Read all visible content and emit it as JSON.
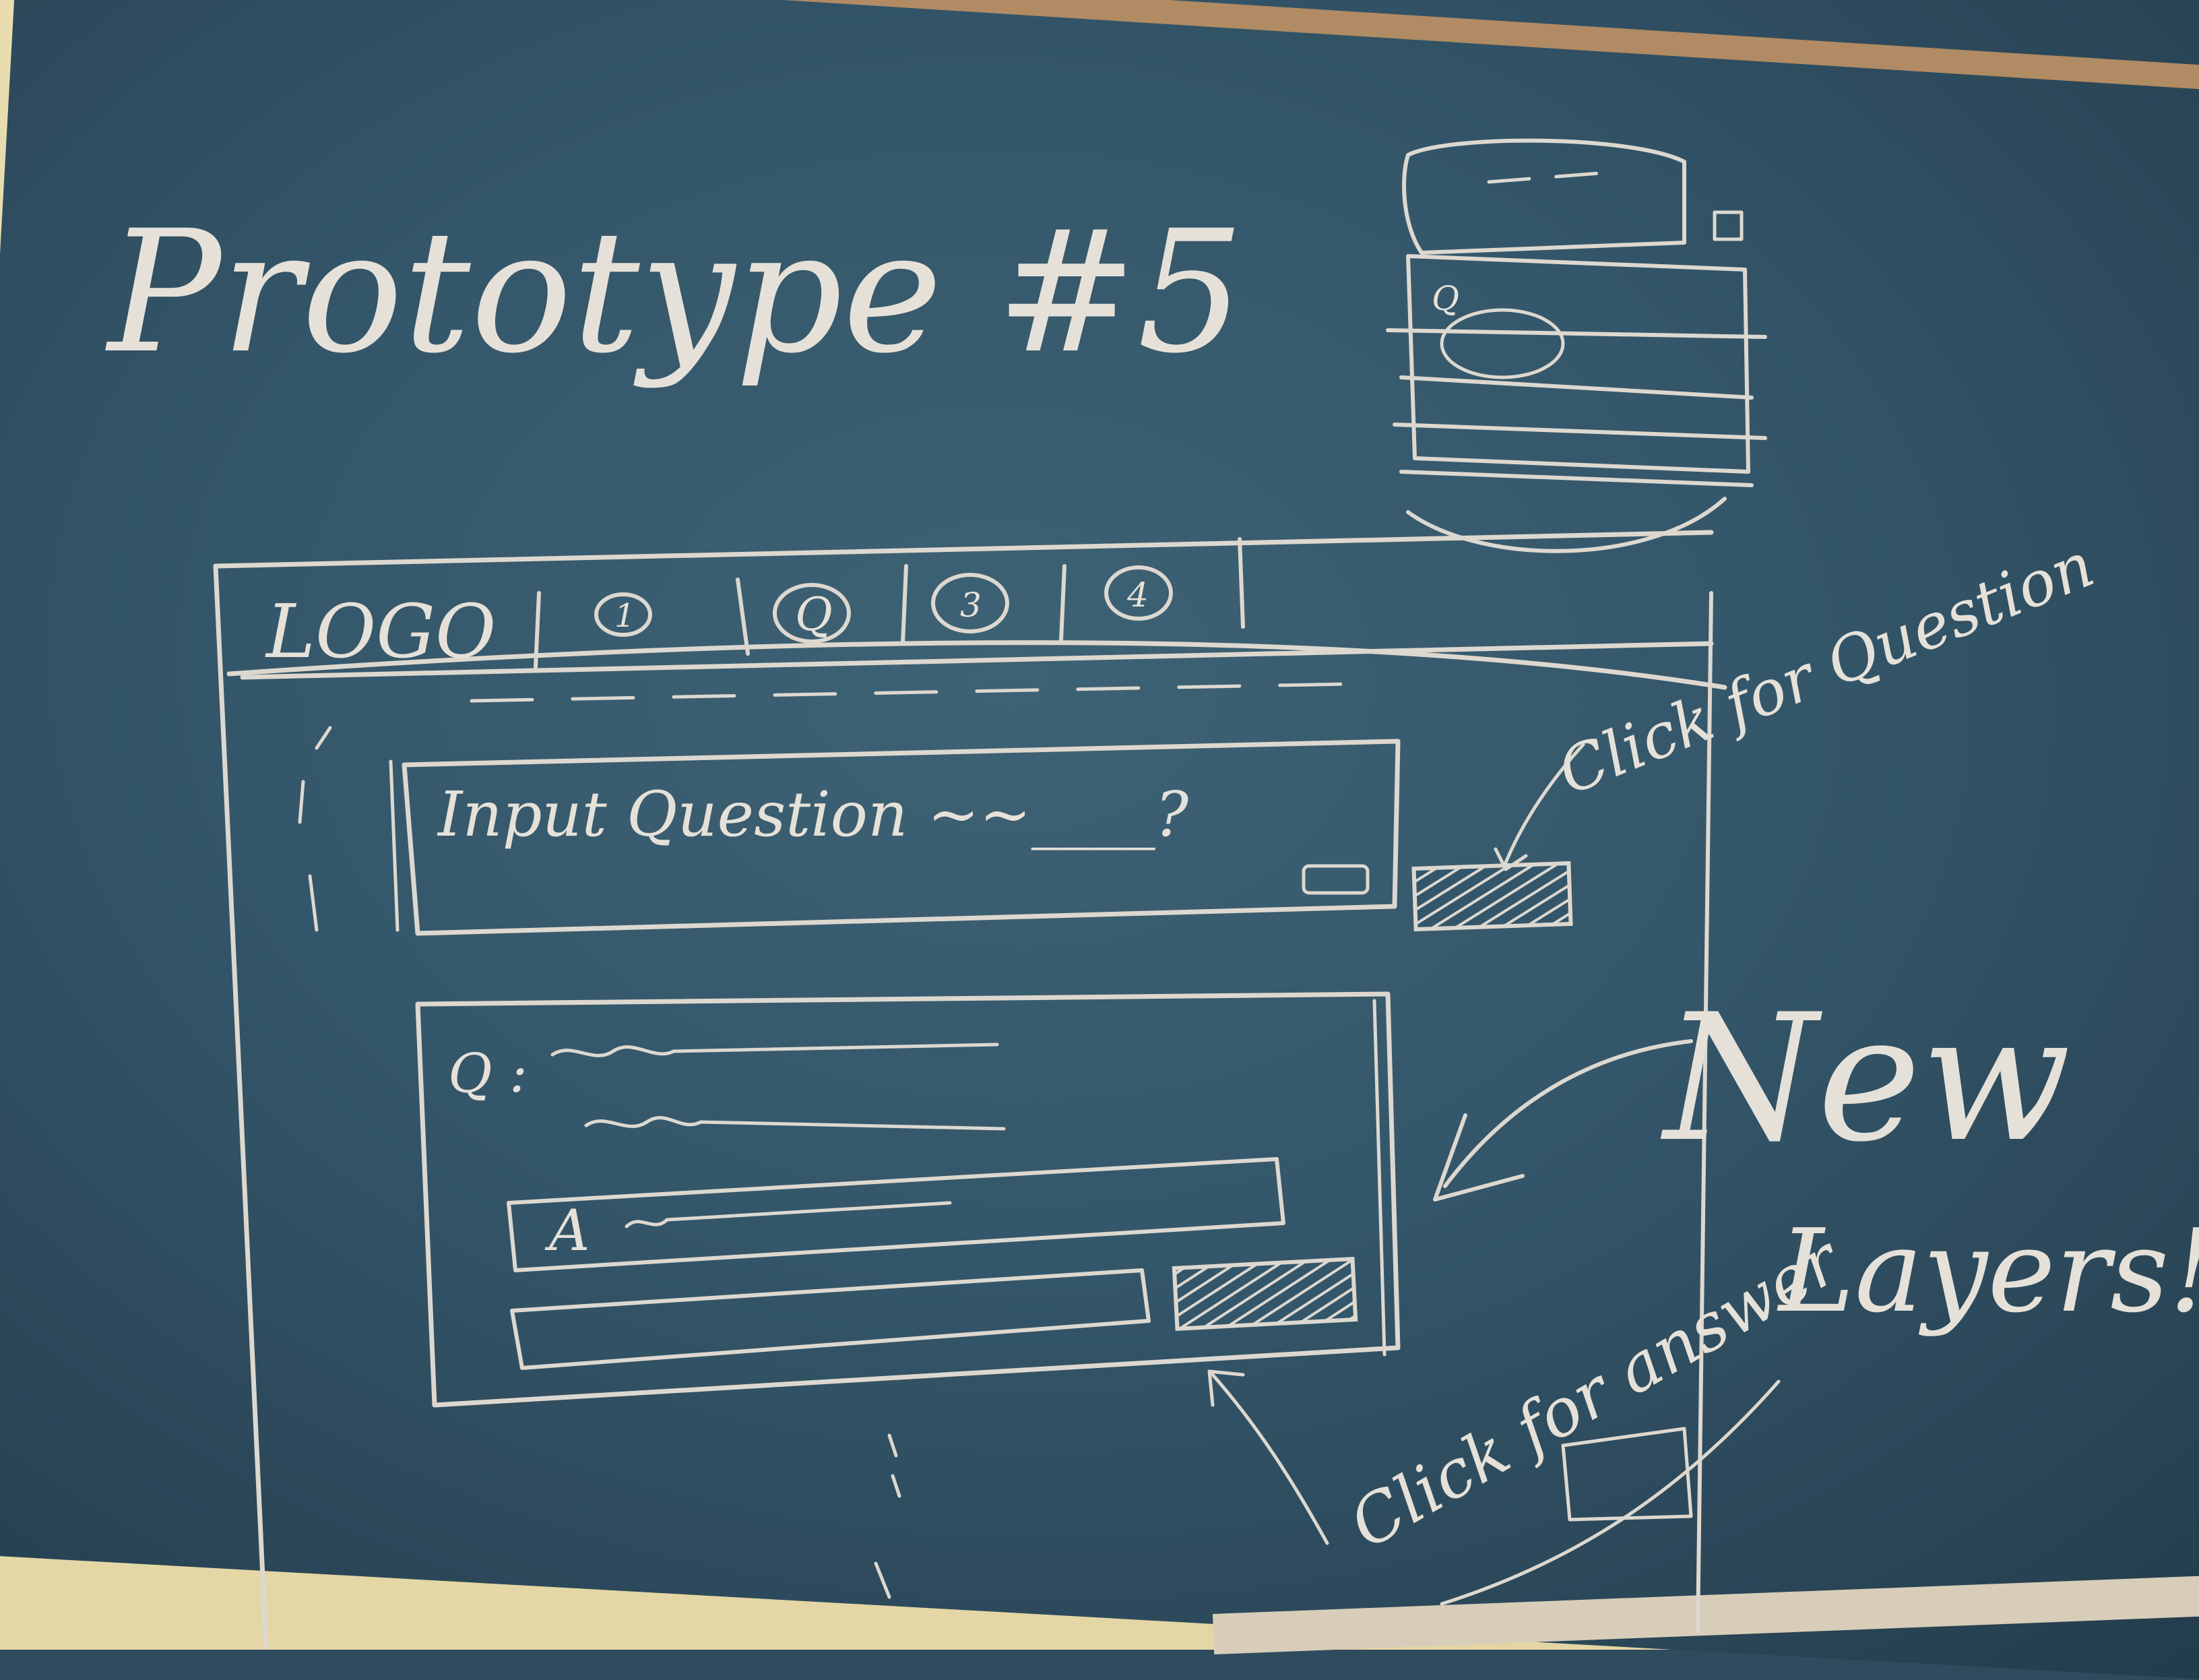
{
  "title": "Prototype #5",
  "nav": {
    "logo": "LOGO",
    "tabs": [
      "1",
      "Q",
      "3",
      "4"
    ]
  },
  "question_box": {
    "placeholder": "Input Question ~~____?"
  },
  "answer_card": {
    "q_label": "Q :",
    "a_label": "A"
  },
  "annotations": {
    "click_question": "Click for Question",
    "click_answer": "Click for answer",
    "new_layers": [
      "New",
      "Layers!!"
    ]
  },
  "colors": {
    "board": "#34566a",
    "chalk": "#ddd8cf",
    "wall": "#e6d9a8",
    "rail": "#b08b63"
  }
}
